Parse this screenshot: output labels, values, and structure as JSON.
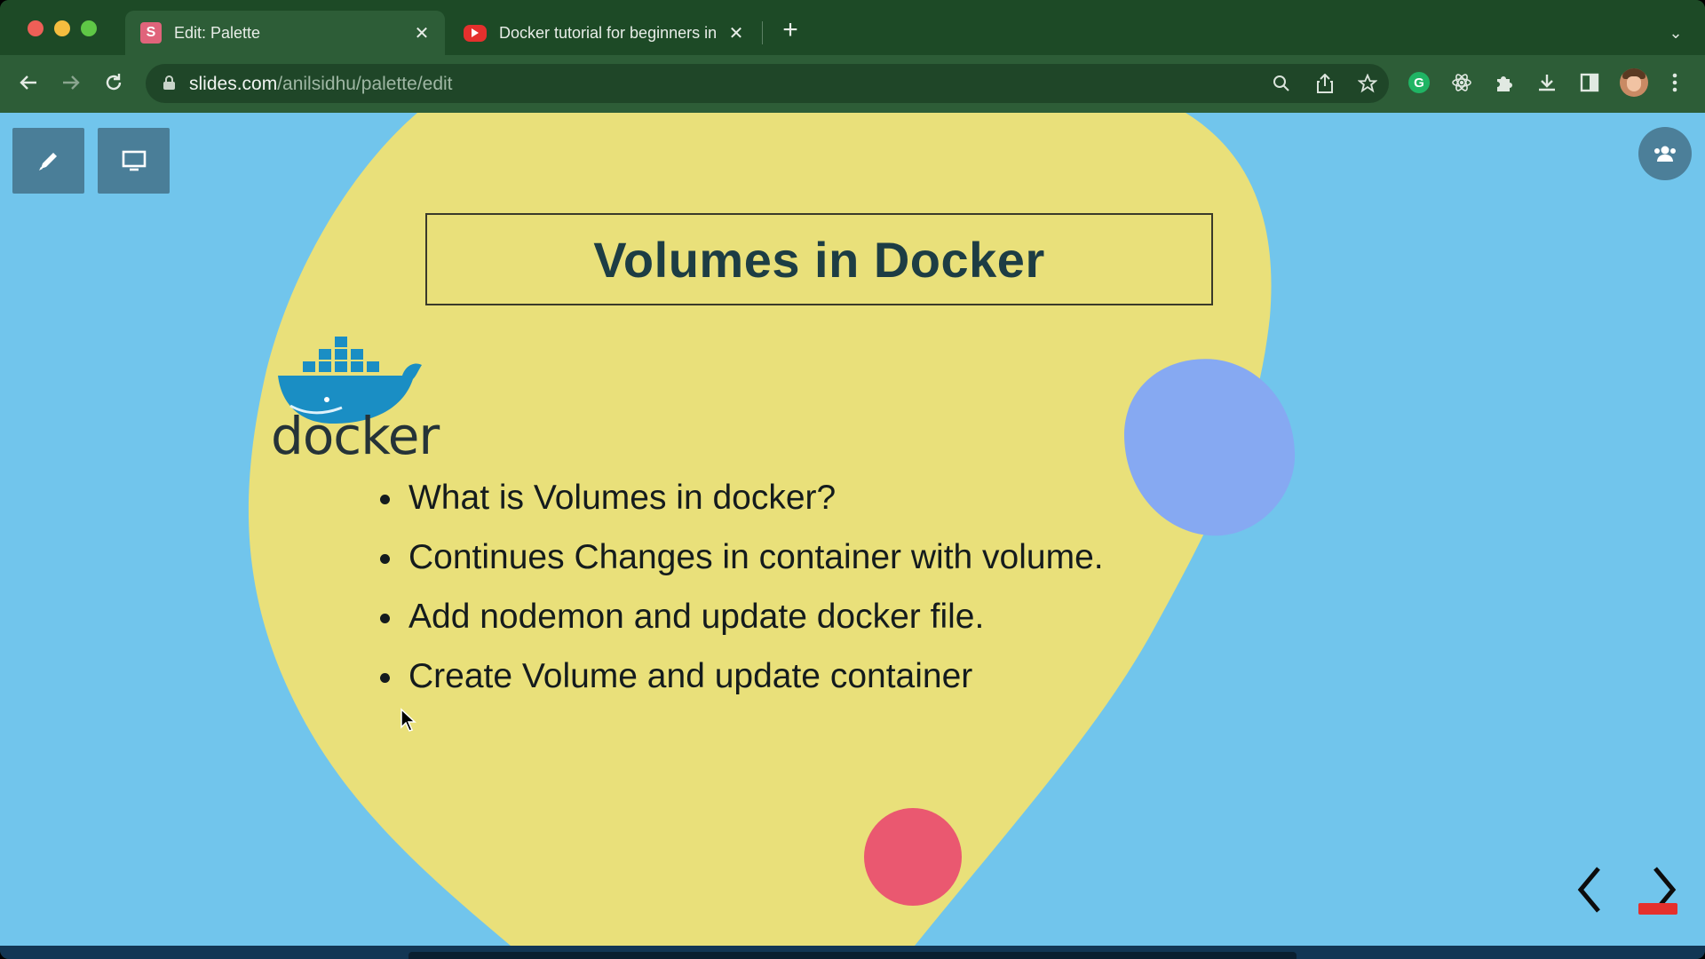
{
  "browser": {
    "tabs": [
      {
        "favicon_letter": "S",
        "title": "Edit: Palette",
        "active": true
      },
      {
        "title": "Docker tutorial for beginners in",
        "active": false
      }
    ],
    "close_glyph": "✕",
    "new_tab_glyph": "+",
    "tab_menu_glyph": "⌄",
    "address": {
      "host": "slides.com",
      "path": "/anilsidhu/palette/edit"
    }
  },
  "slide": {
    "title": "Volumes in Docker",
    "logo_text": "docker",
    "bullets": [
      "What is Volumes in docker?",
      "Continues Changes in container with volume.",
      "Add nodemon and update docker file.",
      "Create Volume and update container"
    ]
  },
  "colors": {
    "stage_bg": "#71c5ec",
    "blob_yellow": "#e9e07a",
    "blob_blue": "#86a9f2",
    "blob_pink": "#ea5870",
    "chrome_frame": "#1d4a26"
  },
  "icons": {
    "back": "arrow-left-icon",
    "forward": "arrow-right-icon",
    "reload": "reload-icon",
    "lock": "lock-icon",
    "zoom": "magnifier-icon",
    "share": "share-icon",
    "bookmark": "star-icon",
    "grammarly": "grammarly-icon",
    "react": "react-devtools-icon",
    "extensions": "puzzle-icon",
    "download": "download-icon",
    "sidepanel": "side-panel-icon",
    "menu": "kebab-menu-icon",
    "pen": "pen-icon",
    "present": "monitor-icon",
    "collaborate": "people-icon",
    "prev": "chevron-left-icon",
    "next": "chevron-right-icon"
  }
}
